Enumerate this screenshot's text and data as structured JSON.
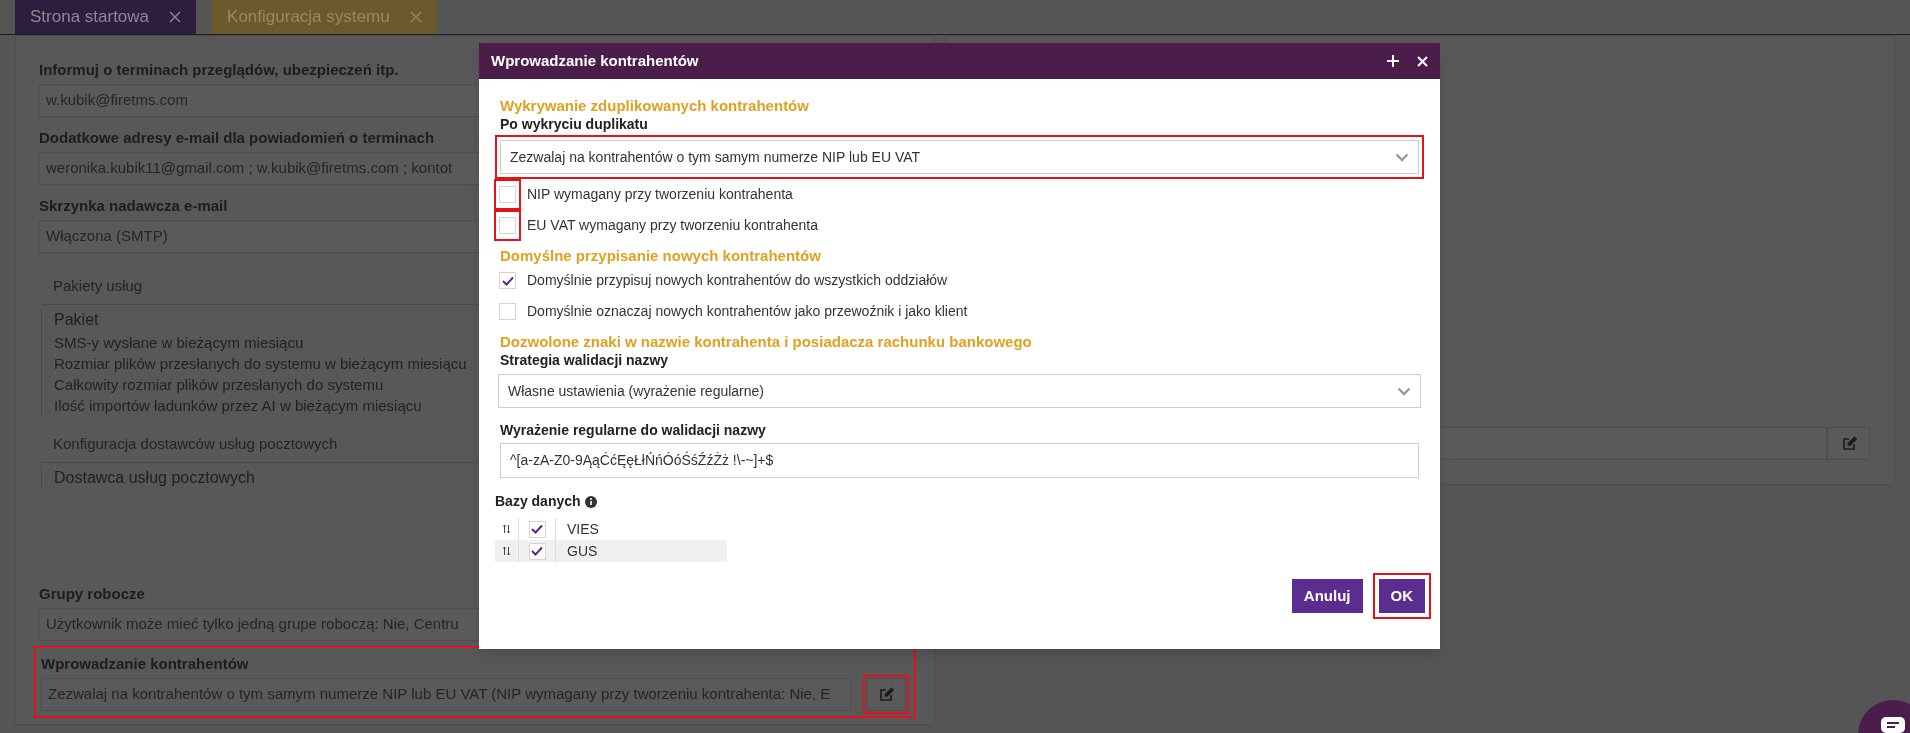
{
  "tabs": [
    {
      "label": "Strona startowa",
      "selected": false,
      "color": "#2e1d3c"
    },
    {
      "label": "Konfiguracja systemu",
      "selected": true,
      "color": "#6b5a2b"
    }
  ],
  "settings": [
    {
      "kind": "field",
      "label": "Informuj o terminach przeglądów, ubezpieczeń itp.",
      "value": "w.kubik@firetms.com"
    },
    {
      "kind": "field",
      "label": "Dodatkowe adresy e-mail dla powiadomień o terminach",
      "value": "weronika.kubik11@gmail.com ; w.kubik@firetms.com ; kontot"
    },
    {
      "kind": "field",
      "label": "Skrzynka nadawcza e-mail",
      "value": "Włączona (SMTP)"
    },
    {
      "kind": "table",
      "title": "Pakiety usług",
      "header": "Pakiet",
      "rows": [
        "SMS-y wysłane w bieżącym miesiącu",
        "Rozmiar plików przesłanych do systemu w bieżącym miesiącu",
        "Całkowity rozmiar plików przesłanych do systemu",
        "Ilość importów ładunków przez AI w bieżącym miesiącu"
      ]
    },
    {
      "kind": "table",
      "title": "Konfiguracja dostawców usług pocztowych",
      "header": "Dostawca usług pocztowych"
    },
    {
      "kind": "field",
      "label": "Grupy robocze",
      "value": "Użytkownik może mieć tylko jedną grupe roboczą: Nie, Centru"
    },
    {
      "kind": "field",
      "label": "Wprowadzanie kontrahentów",
      "value": "Zezwalaj na kontrahentów o tym samym numerze NIP lub EU VAT (NIP wymagany przy tworzeniu kontrahenta: Nie, E",
      "highlighted": true,
      "edit": {
        "highlighted": true
      }
    }
  ],
  "dialog": {
    "title": "Wprowadzanie kontrahentów",
    "items": [
      {
        "kind": "heading",
        "text": "Wykrywanie zduplikowanych kontrahentów"
      },
      {
        "kind": "label",
        "text": "Po wykryciu duplikatu"
      },
      {
        "kind": "select",
        "value": "Zezwalaj na kontrahentów o tym samym numerze NIP lub EU VAT",
        "highlighted": true
      },
      {
        "kind": "checkbox",
        "label": "NIP wymagany przy tworzeniu kontrahenta",
        "checked": false,
        "highlighted": true
      },
      {
        "kind": "checkbox",
        "label": "EU VAT wymagany przy tworzeniu kontrahenta",
        "checked": false,
        "highlighted": true
      },
      {
        "kind": "heading",
        "text": "Domyślne przypisanie nowych kontrahentów"
      },
      {
        "kind": "checkbox",
        "label": "Domyślnie przypisuj nowych kontrahentów do wszystkich oddziałów",
        "checked": true,
        "highlighted": false
      },
      {
        "kind": "checkbox",
        "label": "Domyślnie oznaczaj nowych kontrahentów jako przewoźnik i jako klient",
        "checked": false,
        "highlighted": false
      },
      {
        "kind": "heading",
        "text": "Dozwolone znaki w nazwie kontrahenta i posiadacza rachunku bankowego"
      },
      {
        "kind": "label",
        "text": "Strategia walidacji nazwy"
      },
      {
        "kind": "select",
        "value": "Własne ustawienia (wyrażenie regularne)",
        "highlighted": false
      },
      {
        "kind": "label",
        "text": "Wyrażenie regularne do walidacji nazwy"
      },
      {
        "kind": "input",
        "value": "^[a-zA-Z0-9ĄąĆćĘęŁłŃńÓóŚśŹźŻż !\\-~]+$"
      }
    ],
    "databases": {
      "label": "Bazy danych",
      "rows": [
        {
          "name": "VIES",
          "checked": true
        },
        {
          "name": "GUS",
          "checked": true
        }
      ]
    },
    "buttons": [
      {
        "label": "Anuluj",
        "highlighted": false
      },
      {
        "label": "OK",
        "highlighted": true
      }
    ]
  }
}
